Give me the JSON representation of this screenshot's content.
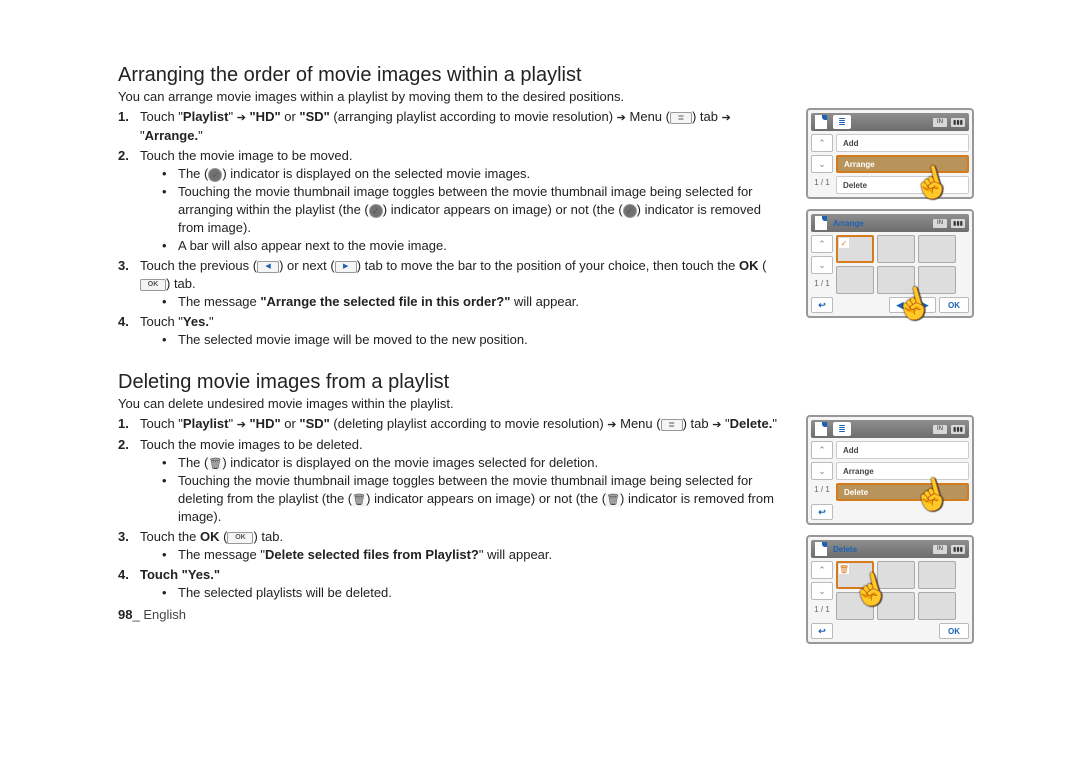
{
  "section1": {
    "title": "Arranging the order of movie images within a playlist",
    "intro": "You can arrange movie images within a playlist by moving them to the desired positions.",
    "s1_1a": "Touch \"",
    "s1_1b": "Playlist",
    "s1_1c": "\" ",
    "s1_1d": " \"HD\" ",
    "s1_1e": "or",
    "s1_1f": " \"SD\" ",
    "s1_1g": "(arranging playlist according to movie resolution) ",
    "s1_1h": "Menu (",
    "s1_1i": ") tab ",
    "s1_1j": " \"",
    "s1_1k": "Arrange.",
    "s1_1l": "\"",
    "s1_2": "Touch the movie image to be moved.",
    "s1_2a_a": "The (",
    "s1_2a_b": ") indicator is displayed on the selected movie images.",
    "s1_2b_a": "Touching the movie thumbnail image toggles between the movie thumbnail image being selected for arranging within the playlist (the (",
    "s1_2b_b": ") indicator appears on image) or not (the (",
    "s1_2b_c": ") indicator is removed from image).",
    "s1_2c": "A bar will also appear next to the movie image.",
    "s1_3a": "Touch the previous (",
    "s1_3b": ") or next (",
    "s1_3c": ") tab to move the bar to the position of your choice, then touch the ",
    "s1_3d": "OK",
    "s1_3e": " (",
    "s1_3f": ") tab.",
    "s1_3g_a": "The message ",
    "s1_3g_b": "\"Arrange the selected file in this order?\"",
    "s1_3g_c": " will appear.",
    "s1_4a": "Touch \"",
    "s1_4b": "Yes.",
    "s1_4c": "\"",
    "s1_4d": "The selected movie image will be moved to the new position."
  },
  "section2": {
    "title": "Deleting movie images from a playlist",
    "intro": "You can delete undesired movie images within the playlist.",
    "s2_1a": "Touch \"",
    "s2_1b": "Playlist",
    "s2_1c": "\" ",
    "s2_1d": " \"HD\" ",
    "s2_1e": "or",
    "s2_1f": " \"SD\" ",
    "s2_1g": "(deleting playlist according to movie resolution) ",
    "s2_1h": "Menu (",
    "s2_1i": ") tab ",
    "s2_1j": " \"",
    "s2_1k": "Delete.",
    "s2_1l": "\"",
    "s2_2": "Touch the movie images to be deleted.",
    "s2_2a_a": "The (",
    "s2_2a_b": ") indicator is displayed on the movie images selected for deletion.",
    "s2_2b_a": "Touching the movie thumbnail image toggles between the movie thumbnail image being selected for deleting from the playlist (the (",
    "s2_2b_b": ") indicator appears on image) or not (the (",
    "s2_2b_c": ") indicator is removed from image).",
    "s2_3a": "Touch the ",
    "s2_3b": "OK",
    "s2_3c": " (",
    "s2_3d": ") tab.",
    "s2_3e_a": "The message \"",
    "s2_3e_b": "Delete selected files from Playlist?",
    "s2_3e_c": "\" will appear.",
    "s2_4a": "Touch \"",
    "s2_4b": "Yes.",
    "s2_4c": "\"",
    "s2_4d": "The selected playlists will be deleted."
  },
  "fig": {
    "add": "Add",
    "arrange": "Arrange",
    "delete": "Delete",
    "ok": "OK",
    "page": "1 / 1",
    "in": "IN"
  },
  "footer": {
    "page": "98",
    "sep": "_ ",
    "lang": "English"
  }
}
